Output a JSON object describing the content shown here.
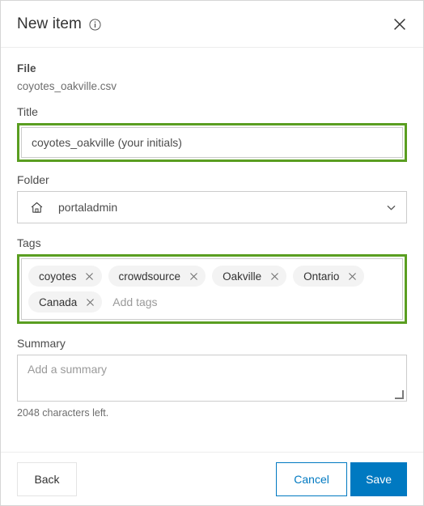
{
  "header": {
    "title": "New item",
    "info_icon": "info-circle-icon",
    "close_icon": "close-icon"
  },
  "form": {
    "file": {
      "label": "File",
      "value": "coyotes_oakville.csv"
    },
    "title": {
      "label": "Title",
      "value": "coyotes_oakville (your initials)",
      "highlighted": true
    },
    "folder": {
      "label": "Folder",
      "value": "portaladmin",
      "icon": "home-icon",
      "chevron_icon": "chevron-down-icon"
    },
    "tags": {
      "label": "Tags",
      "highlighted": true,
      "chips": [
        "coyotes",
        "crowdsource",
        "Oakville",
        "Ontario",
        "Canada"
      ],
      "remove_icon": "close-small-icon",
      "placeholder": "Add tags"
    },
    "summary": {
      "label": "Summary",
      "value": "",
      "placeholder": "Add a summary",
      "char_count": "2048 characters left.",
      "resize_handle_icon": "resize-handle-icon"
    }
  },
  "footer": {
    "back_label": "Back",
    "cancel_label": "Cancel",
    "save_label": "Save"
  },
  "colors": {
    "accent_blue": "#0079c1",
    "highlight_green": "#5a9e21",
    "chip_bg": "#f3f3f3",
    "border_grey": "#cccccc",
    "text_dark": "#323232",
    "text_muted": "#6e6e6e",
    "placeholder": "#9a9a9a"
  }
}
